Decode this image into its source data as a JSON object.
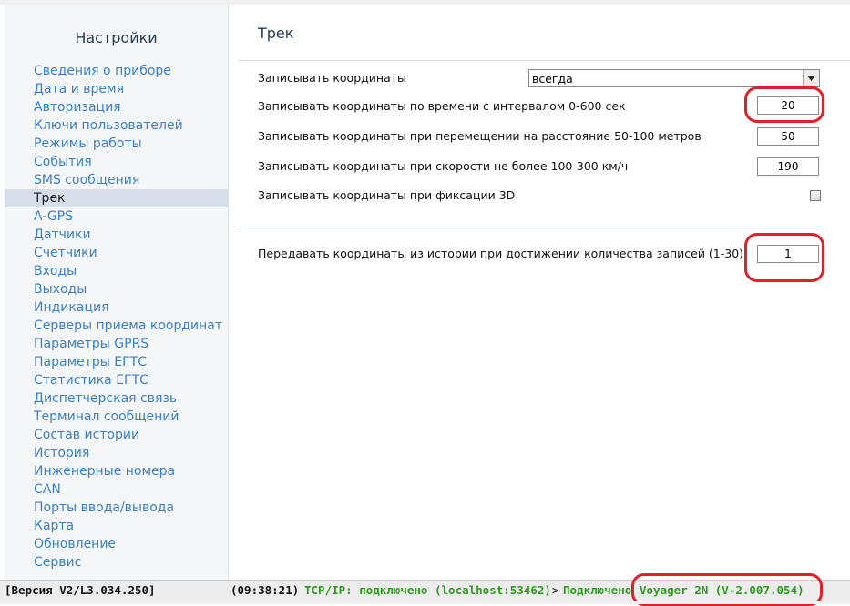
{
  "sidebar": {
    "title": "Настройки",
    "items": [
      {
        "label": "Сведения о приборе"
      },
      {
        "label": "Дата и время"
      },
      {
        "label": "Авторизация"
      },
      {
        "label": "Ключи пользователей"
      },
      {
        "label": "Режимы работы"
      },
      {
        "label": "События"
      },
      {
        "label": "SMS сообщения"
      },
      {
        "label": "Трек",
        "active": true
      },
      {
        "label": "A-GPS"
      },
      {
        "label": "Датчики"
      },
      {
        "label": "Счетчики"
      },
      {
        "label": "Входы"
      },
      {
        "label": "Выходы"
      },
      {
        "label": "Индикация"
      },
      {
        "label": "Серверы приема координат"
      },
      {
        "label": "Параметры GPRS"
      },
      {
        "label": "Параметры ЕГТС"
      },
      {
        "label": "Статистика ЕГТС"
      },
      {
        "label": "Диспетчерская связь"
      },
      {
        "label": "Терминал сообщений"
      },
      {
        "label": "Состав истории"
      },
      {
        "label": "История"
      },
      {
        "label": "Инженерные номера"
      },
      {
        "label": "CAN"
      },
      {
        "label": "Порты ввода/вывода"
      },
      {
        "label": "Карта"
      },
      {
        "label": "Обновление"
      },
      {
        "label": "Сервис"
      }
    ]
  },
  "main": {
    "title": "Трек",
    "record_mode": {
      "label": "Записывать координаты",
      "selected": "всегда"
    },
    "interval": {
      "label": "Записывать координаты по времени с интервалом 0-600 сек",
      "value": "20"
    },
    "distance": {
      "label": "Записывать координаты при перемещении на расстояние 50-100 метров",
      "value": "50"
    },
    "speed": {
      "label": "Записывать координаты при скорости не более 100-300 км/ч",
      "value": "190"
    },
    "fix3d": {
      "label": "Записывать координаты при фиксации 3D",
      "checked": false
    },
    "history_send": {
      "label": "Передавать координаты из истории при достижении количества записей (1-30)",
      "value": "1"
    }
  },
  "statusbar": {
    "version": "[Версия V2/L3.034.250]",
    "time": "(09:38:21)",
    "connection": "TCP/IP: подключено (localhost:53462)",
    "arrow": ">",
    "connection2": "Подключено",
    "device": "Voyager 2N (V-2.007.054)"
  },
  "colors": {
    "link": "#3b7fc4",
    "active_bg": "#d6dfe9",
    "status_green": "#2e9a1e",
    "highlight_red": "#e0202a"
  },
  "icons": {
    "dropdown": "chevron-down-icon"
  }
}
